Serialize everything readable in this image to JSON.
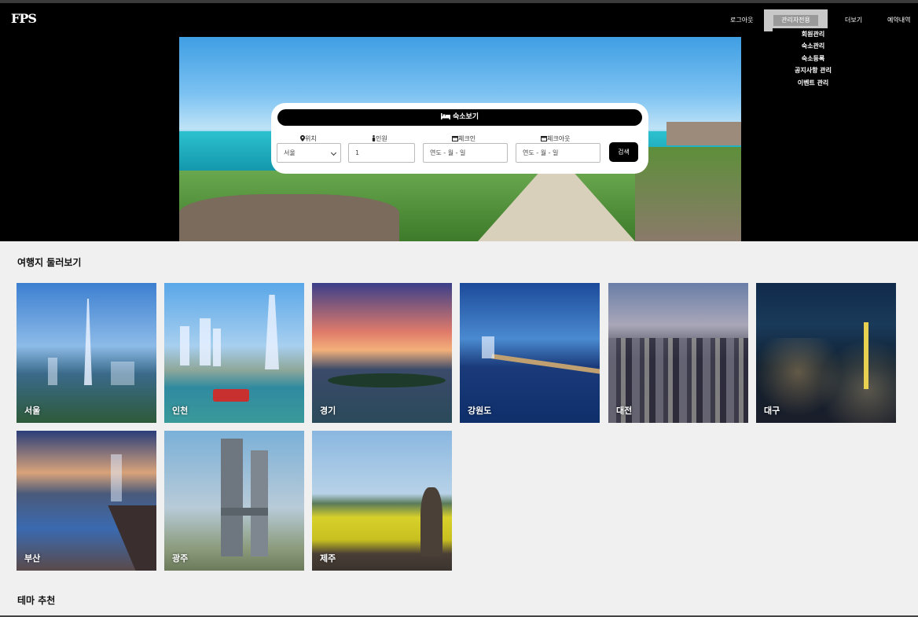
{
  "brand": {
    "logo_text": "FPS"
  },
  "nav": {
    "logout": "로그아웃",
    "admin": "관리자전용",
    "more": "더보기",
    "reservations": "예약내역",
    "admin_menu": [
      "회원관리",
      "숙소관리",
      "숙소등록",
      "공지사항 관리",
      "이벤트 관리"
    ]
  },
  "search": {
    "title": "숙소보기",
    "title_icon": "bed-icon",
    "location_label": "위치",
    "location_icon": "map-pin-icon",
    "location_value": "서울",
    "guests_label": "인원",
    "guests_icon": "person-icon",
    "guests_value": "1",
    "checkin_label": "체크인",
    "checkin_icon": "calendar-icon",
    "checkin_placeholder": "연도 - 월 - 일",
    "checkout_label": "체크아웃",
    "checkout_icon": "calendar-icon",
    "checkout_placeholder": "연도 - 월 - 일",
    "button": "검색"
  },
  "destinations": {
    "title": "여행지 둘러보기",
    "cities": [
      "서울",
      "인천",
      "경기",
      "강원도",
      "대전",
      "대구",
      "부산",
      "광주",
      "제주"
    ]
  },
  "theme": {
    "title": "테마 추천"
  }
}
